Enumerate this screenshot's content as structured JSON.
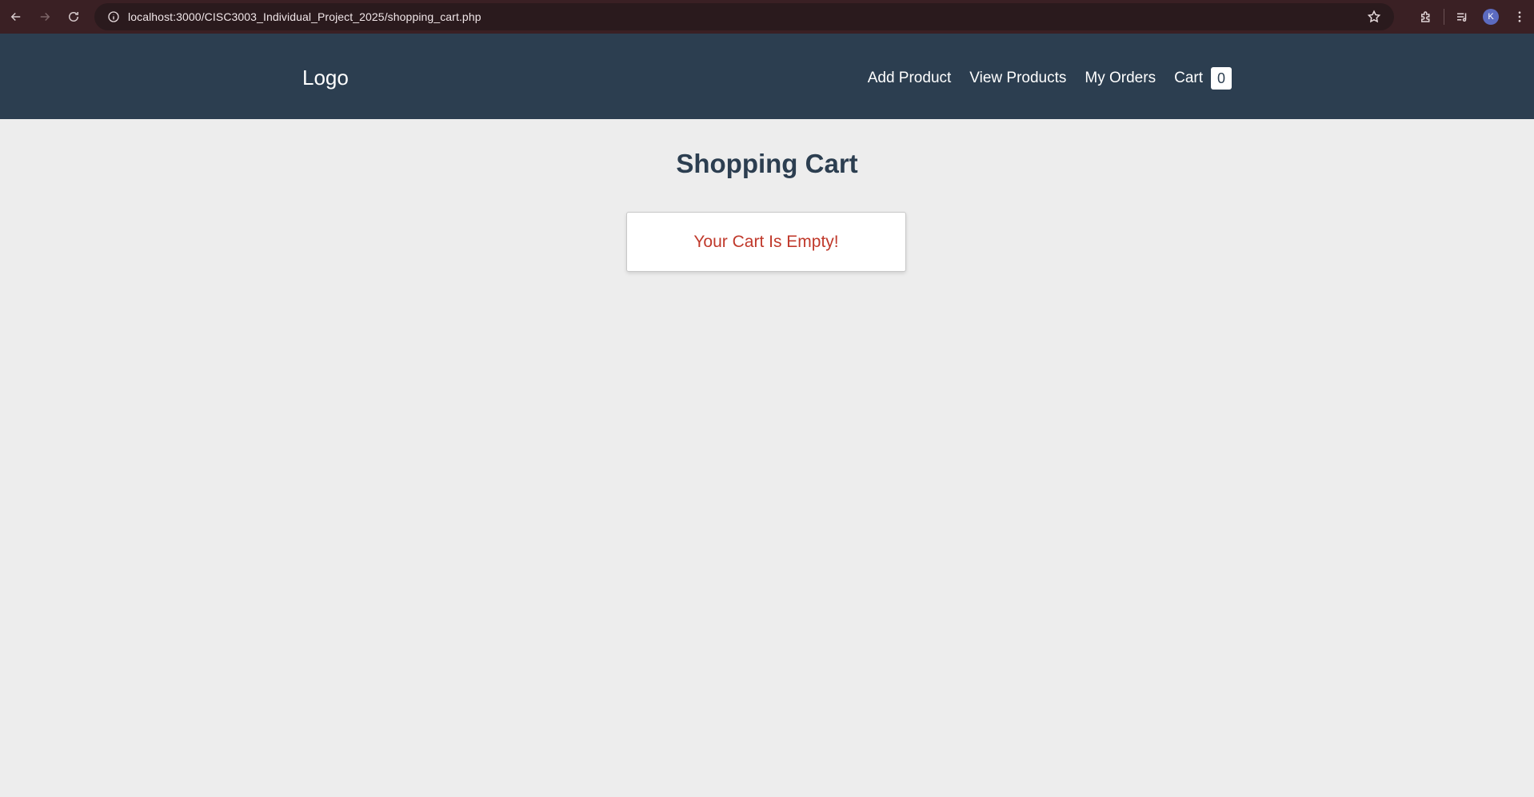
{
  "browser": {
    "url": "localhost:3000/CISC3003_Individual_Project_2025/shopping_cart.php",
    "profile_initial": "K",
    "icons": {
      "back": "back-arrow-icon",
      "forward": "forward-arrow-icon",
      "reload": "reload-icon",
      "site_info": "site-info-icon",
      "bookmark": "star-icon",
      "extensions": "puzzle-icon",
      "media": "media-queue-icon",
      "menu": "kebab-menu-icon"
    }
  },
  "header": {
    "logo": "Logo",
    "nav": {
      "add_product": "Add Product",
      "view_products": "View Products",
      "my_orders": "My Orders",
      "cart": "Cart",
      "cart_count": "0"
    }
  },
  "main": {
    "title": "Shopping Cart",
    "empty_message": "Your Cart Is Empty!"
  },
  "colors": {
    "browser_bar": "#3a2024",
    "header_bg": "#2c3e50",
    "page_bg": "#ededed",
    "title": "#2c3e50",
    "empty_message": "#c0392b"
  }
}
